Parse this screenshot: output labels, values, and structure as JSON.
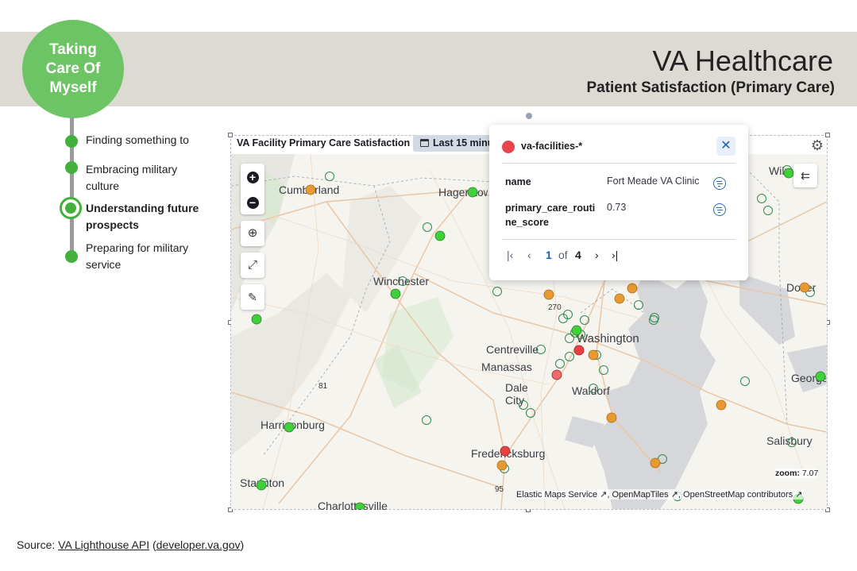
{
  "header": {
    "badge_text": "Taking Care Of Myself",
    "title": "VA Healthcare",
    "subtitle": "Patient Satisfaction (Primary Care)"
  },
  "timeline": {
    "items": [
      {
        "label": "Finding something to",
        "active": false
      },
      {
        "label": "Embracing military culture",
        "active": false
      },
      {
        "label": "Understanding future prospects",
        "active": true
      },
      {
        "label": "Preparing for military service",
        "active": false
      }
    ]
  },
  "panel": {
    "title": "VA Facility Primary Care Satisfaction",
    "time_range": "Last 15 minu",
    "controls": [
      "zoom-in",
      "zoom-out",
      "locate",
      "fullscreen",
      "tools"
    ]
  },
  "map": {
    "labels": [
      {
        "text": "Cumberland"
      },
      {
        "text": "Hagerstown"
      },
      {
        "text": "Winchester"
      },
      {
        "text": "Washington"
      },
      {
        "text": "Centreville"
      },
      {
        "text": "Manassas"
      },
      {
        "text": "Dale City"
      },
      {
        "text": "Waldorf"
      },
      {
        "text": "Harrisonburg"
      },
      {
        "text": "Fredericksburg"
      },
      {
        "text": "Staunton"
      },
      {
        "text": "Charlottesville"
      },
      {
        "text": "Dover"
      },
      {
        "text": "Salisbury"
      },
      {
        "text": "Georgetown"
      },
      {
        "text": "Wilmington"
      },
      {
        "text": "270"
      },
      {
        "text": "81"
      },
      {
        "text": "95"
      }
    ],
    "legend_colors": {
      "high": "#3fd13a",
      "medium": "#e89a32",
      "low": "#e8413f",
      "hollow": "#2f8a4f"
    },
    "zoom_label": "zoom:",
    "zoom_value": "7.07",
    "attribution": [
      "Elastic Maps Service",
      "OpenMapTiles",
      "OpenStreetMap contributors"
    ]
  },
  "popup": {
    "layer": "va-facilities-*",
    "fields": [
      {
        "key": "name",
        "value": "Fort Meade VA Clinic"
      },
      {
        "key": "primary_care_routine_score",
        "value": "0.73"
      }
    ],
    "page_current": "1",
    "page_of": "of",
    "page_total": "4"
  },
  "footer": {
    "source_label": "Source:",
    "source_link": "VA Lighthouse API",
    "source_domain": "developer.va.gov"
  }
}
